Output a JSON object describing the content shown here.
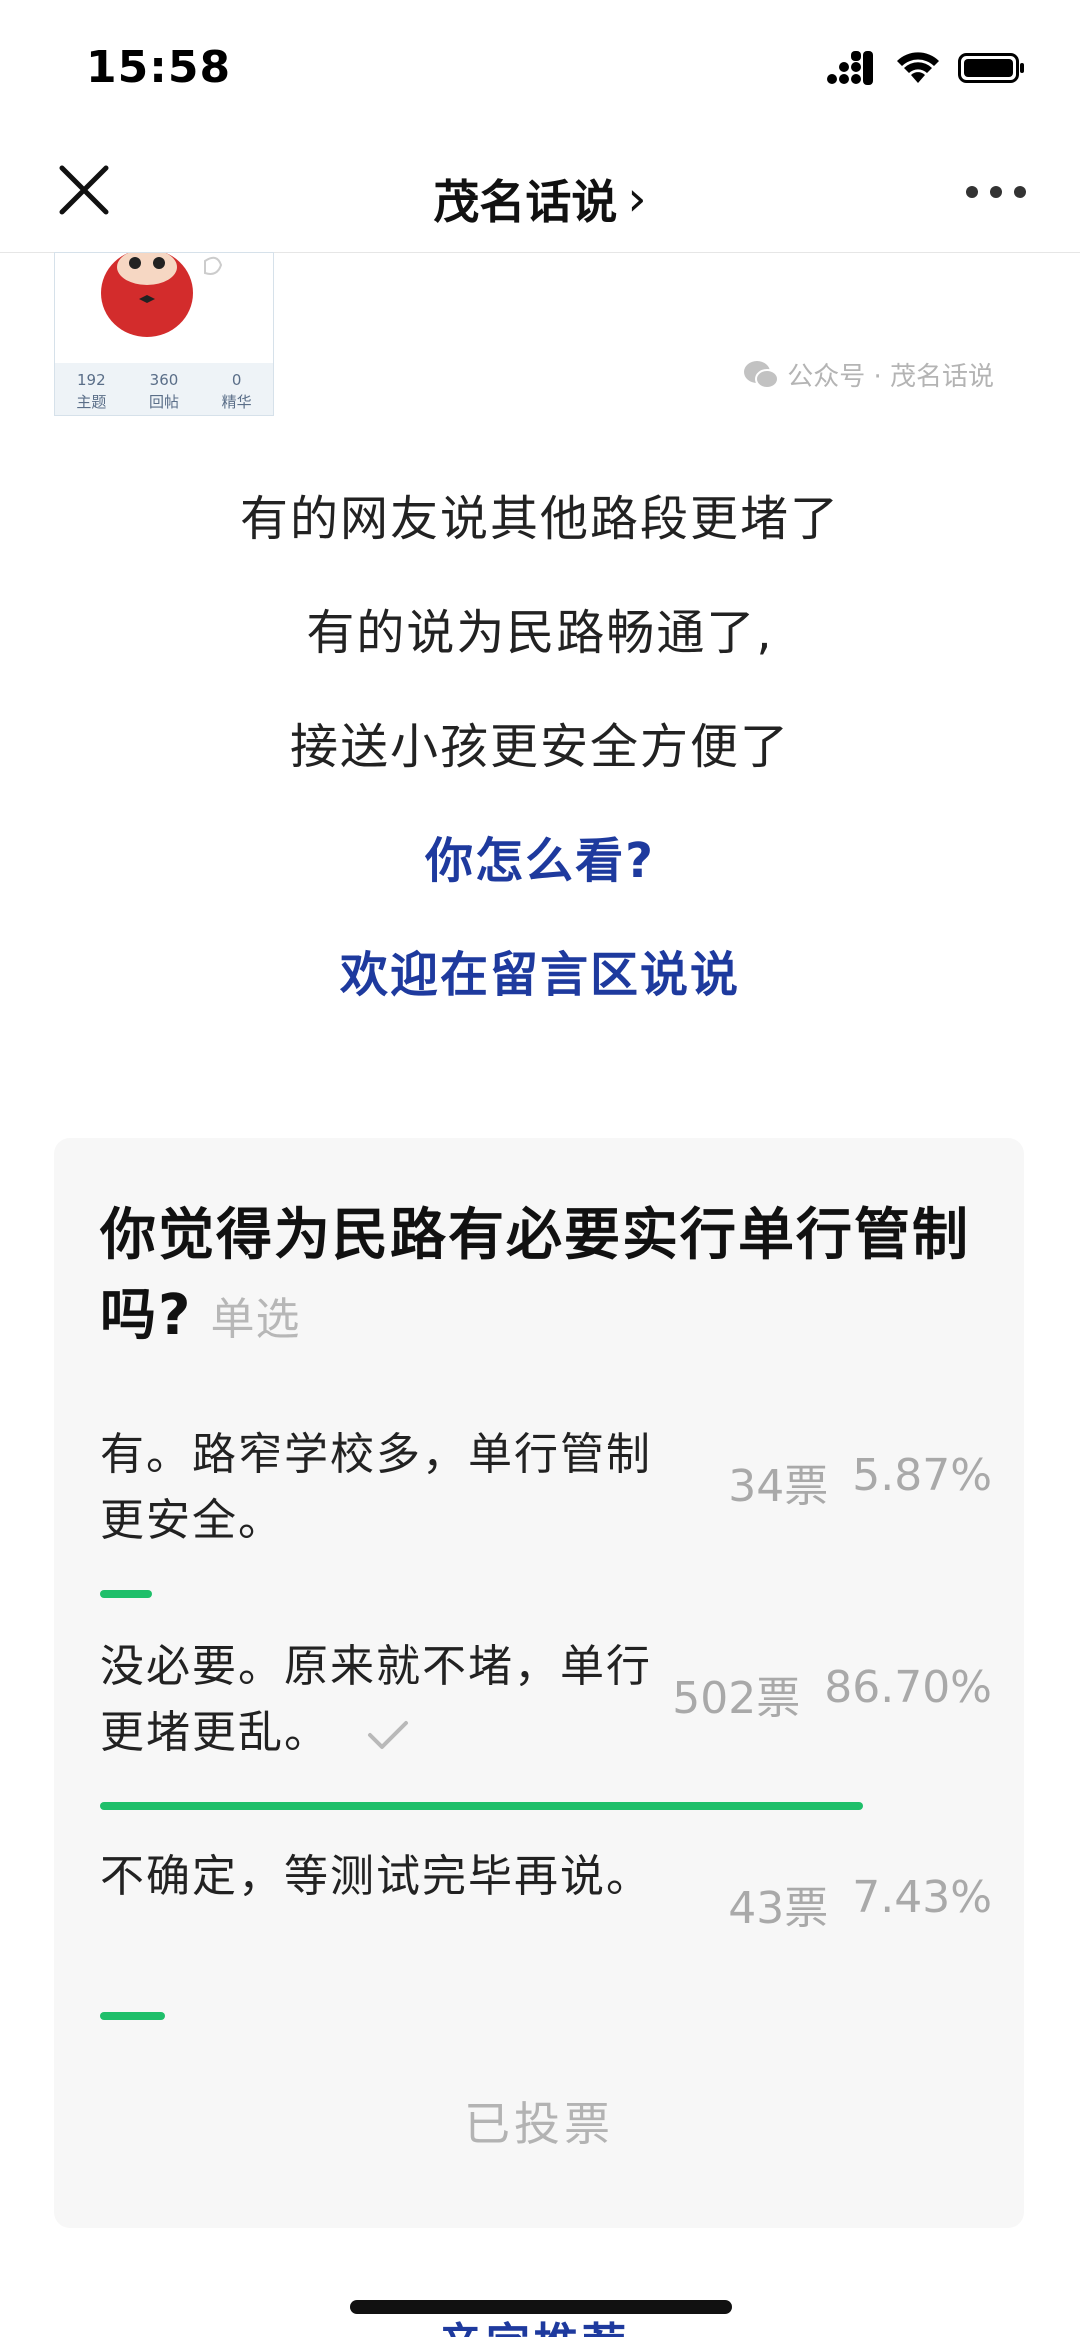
{
  "status_bar": {
    "time": "15:58"
  },
  "nav": {
    "title": "茂名话说",
    "title_chevron": "›",
    "close_icon": "close-icon",
    "more_icon": "more-icon"
  },
  "thumbnail": {
    "stats": [
      {
        "value": "192",
        "label": "主题"
      },
      {
        "value": "360",
        "label": "回帖"
      },
      {
        "value": "0",
        "label": "精华"
      }
    ]
  },
  "watermark": {
    "text": "公众号 · 茂名话说"
  },
  "article": {
    "lines": [
      "有的网友说其他路段更堵了",
      "有的说为民路畅通了,",
      "接送小孩更安全方便了"
    ],
    "emphasis": [
      "你怎么看?",
      "欢迎在留言区说说"
    ]
  },
  "vote": {
    "question": "你觉得为民路有必要实行单行管制吗?",
    "type_label": "单选",
    "options": [
      {
        "text": "有。路窄学校多，单行管制更安全。",
        "votes": "34票",
        "percent_label": "5.87%",
        "percent": 5.87,
        "selected": false
      },
      {
        "text": "没必要。原来就不堵，单行更堵更乱。",
        "votes": "502票",
        "percent_label": "86.70%",
        "percent": 86.7,
        "selected": true
      },
      {
        "text": "不确定，等测试完毕再说。",
        "votes": "43票",
        "percent_label": "7.43%",
        "percent": 7.43,
        "selected": false
      }
    ],
    "status": "已投票",
    "bar_color": "#1fbf6a"
  },
  "bottom": {
    "fragment_text": "亲字推荐"
  },
  "colors": {
    "accent_blue": "#1e3a9e",
    "vote_green": "#1fbf6a",
    "muted_gray": "#a9a9a9"
  }
}
